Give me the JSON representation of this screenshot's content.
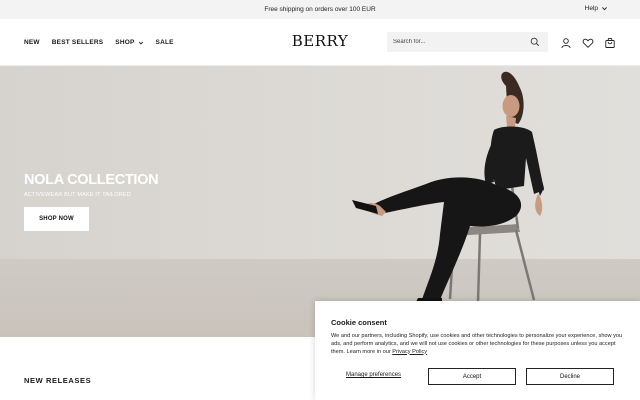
{
  "announcement": {
    "message": "Free shipping on orders over 100 EUR",
    "help_label": "Help"
  },
  "header": {
    "logo": "BERRY",
    "nav": [
      {
        "label": "NEW"
      },
      {
        "label": "BEST SELLERS"
      },
      {
        "label": "SHOP",
        "has_dropdown": true
      },
      {
        "label": "SALE"
      }
    ],
    "search_placeholder": "Search for...",
    "icons": [
      "search-icon",
      "account-icon",
      "wishlist-heart-icon",
      "cart-bag-icon"
    ]
  },
  "hero": {
    "title": "NOLA COLLECTION",
    "subtitle": "ACTIVEWEAR BUT MAKE IT TAILORED",
    "cta_label": "SHOP NOW"
  },
  "section": {
    "title": "NEW RELEASES"
  },
  "cookie": {
    "title": "Cookie consent",
    "body": "We and our partners, including Shopify, use cookies and other technologies to personalize your experience, show you ads, and perform analytics, and we will not use cookies or other technologies for these purposes unless you accept them. Learn more in our",
    "policy_link": "Privacy Policy",
    "manage_label": "Manage preferences",
    "accept_label": "Accept",
    "decline_label": "Decline"
  },
  "colors": {
    "announcement_bg": "#f3f3f3",
    "search_bg": "#f2f2f2",
    "hero_bg": "#d9d6d2",
    "text": "#1a1a1a"
  }
}
